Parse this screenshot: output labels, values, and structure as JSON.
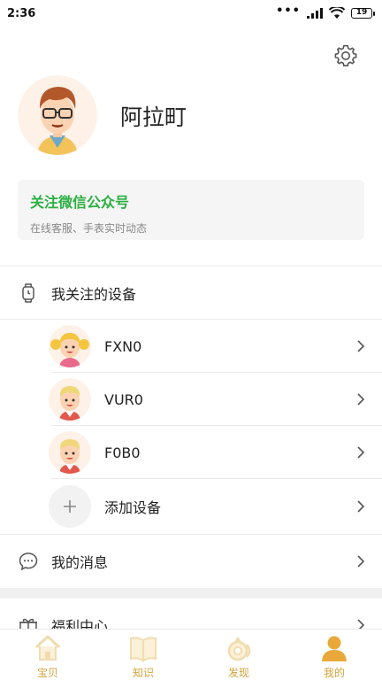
{
  "status_bar": {
    "time": "2:36",
    "signal_dots": "•••",
    "battery": "19"
  },
  "profile": {
    "name": "阿拉町"
  },
  "wechat": {
    "title": "关注微信公众号",
    "subtitle": "在线客服、手表实时动态"
  },
  "devices": {
    "header": "我关注的设备",
    "items": [
      {
        "label": "FXN0"
      },
      {
        "label": "VUR0"
      },
      {
        "label": "F0B0"
      }
    ],
    "add_label": "添加设备"
  },
  "messages": {
    "label": "我的消息"
  },
  "welfare": {
    "label": "福利中心"
  },
  "tabs": [
    {
      "label": "宝贝",
      "icon": "house-icon"
    },
    {
      "label": "知识",
      "icon": "book-icon"
    },
    {
      "label": "发现",
      "icon": "discover-icon"
    },
    {
      "label": "我的",
      "icon": "person-icon"
    }
  ],
  "colors": {
    "accent_green": "#2aaf42",
    "tab_gold": "#d3a33a"
  }
}
